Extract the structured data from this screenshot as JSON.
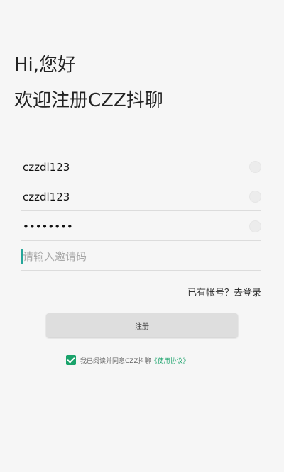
{
  "greeting": "Hi,您好",
  "welcome": "欢迎注册CZZ抖聊",
  "form": {
    "username_value": "czzdl123",
    "password_value": "czzdl123",
    "confirm_value": "••••••••",
    "invite_placeholder": "请输入邀请码"
  },
  "links": {
    "has_account": "已有帐号？去登录"
  },
  "register_button_label": "注册",
  "agreement": {
    "text": "我已阅读并同意CZZ抖聊",
    "link": "《使用协议》",
    "checked": true
  },
  "colors": {
    "accent": "#1aa36b",
    "background": "#f6f6f6"
  }
}
